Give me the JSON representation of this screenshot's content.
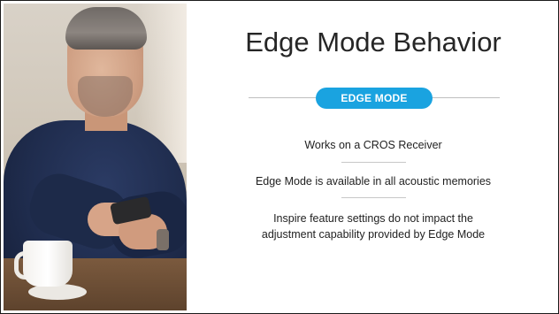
{
  "slide": {
    "title": "Edge Mode Behavior",
    "badge": "EDGE MODE",
    "points": [
      "Works on a CROS Receiver",
      "Edge Mode is available in all acoustic memories",
      "Inspire feature settings do not impact the adjustment capability provided by Edge Mode"
    ]
  },
  "colors": {
    "accent": "#1aa3e0",
    "title_text": "#262626",
    "body_text": "#1f1f1f"
  }
}
